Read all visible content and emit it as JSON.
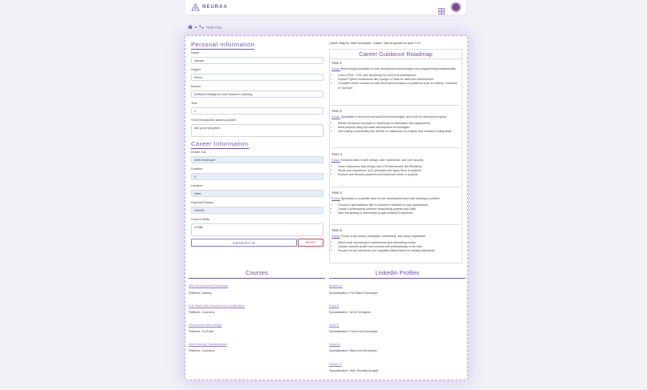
{
  "header": {
    "logo_text": "NEURAA"
  },
  "breadcrumb": {
    "current": "Path Plan"
  },
  "personal": {
    "title": "Personal Information",
    "fields": [
      {
        "label": "Name",
        "value": "Ashwin"
      },
      {
        "label": "Degree",
        "value": "BTech"
      },
      {
        "label": "Branch",
        "value": "Artificial Intelligence And Machine Learning"
      },
      {
        "label": "Year",
        "value": "1"
      },
      {
        "label": "Short Introduction about yourself:",
        "value": "Iam good at python"
      }
    ]
  },
  "career": {
    "title": "Career Information",
    "fields": [
      {
        "label": "Dream Job",
        "value": "Web Developer"
      },
      {
        "label": "Duration",
        "value": "5"
      },
      {
        "label": "Location",
        "value": "India"
      },
      {
        "label": "Expected Salary",
        "value": "100000"
      },
      {
        "label": "Current Skills",
        "value": "NONE"
      }
    ],
    "generate_label": "GENERATE",
    "reset_label": "RESET"
  },
  "roadmap": {
    "heading": "Career Map for Web Developer <class= \"fas fa-spinner fa-spin\"></i>",
    "title": "Career Guidance Roadmap",
    "focus_label": "Focus:",
    "years": [
      {
        "title": "Year 1",
        "focus": "Build strong foundation in web development technologies and programming fundamentals",
        "items": [
          "Learn HTML, CSS, and JavaScript for front-end development",
          "Explore Python frameworks like Django or Flask for back-end development",
          "Complete online courses on web development basics on platforms such as Udemy, Coursera, or YouTube"
        ]
      },
      {
        "title": "Year 2",
        "focus": "Specialize in front-end and back-end technologies, and work on real-world projects",
        "items": [
          "Master advanced concepts in JavaScript for interactive web applications",
          "Build projects using full-stack development technologies",
          "Join coding communities like GitHub to collaborate on projects and enhance coding skills"
        ]
      },
      {
        "title": "Year 3",
        "focus": "Enhance skills in web design, user experience, and web security",
        "items": [
          "Learn responsive web design and CSS frameworks like Bootstrap",
          "Study user experience (UX) principles and apply them to projects",
          "Explore web security practices and implement them in projects"
        ]
      },
      {
        "title": "Year 4",
        "focus": "Specialize in a specific area of web development and start building a portfolio",
        "items": [
          "Choose a specialization like e-commerce websites or web applications",
          "Create a professional portfolio showcasing projects and skills",
          "Start freelancing or internships to gain practical experience"
        ]
      },
      {
        "title": "Year 5",
        "focus": "Focus on job search strategies, networking, and salary negotiation",
        "items": [
          "Attend web development conferences and networking events",
          "Update LinkedIn profile and connect with professionals in the field",
          "Prepare for job interviews and negotiate salary based on industry standards"
        ]
      }
    ]
  },
  "courses": {
    "title": "Courses",
    "platform_label": "Platform:",
    "items": [
      {
        "name": "Web Development Bootcamp",
        "platform": "Udemy"
      },
      {
        "name": "Full Stack Web Development Certification",
        "platform": "Coursera"
      },
      {
        "name": "Responsive Web Design",
        "platform": "YouTube"
      },
      {
        "name": "Web Security Fundamentals",
        "platform": "Coursera"
      }
    ]
  },
  "linkedin": {
    "title": "Linkedin Profiles",
    "spec_label": "Specialization:",
    "items": [
      {
        "name": "Aravind S",
        "spec": "Full Stack Developer"
      },
      {
        "name": "Priya R",
        "spec": "UI/UX Designer"
      },
      {
        "name": "Sahil N",
        "spec": "Front-end Developer"
      },
      {
        "name": "Divya M",
        "spec": "Back-end Developer"
      },
      {
        "name": "Karthik R",
        "spec": "Web Security Analyst"
      }
    ]
  }
}
